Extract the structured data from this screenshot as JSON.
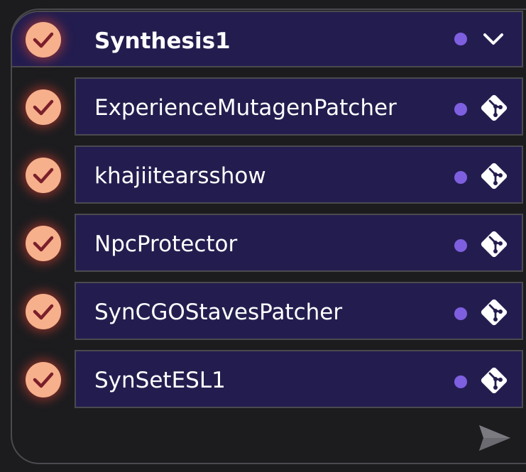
{
  "group": {
    "title": "Synthesis1",
    "checked": true,
    "expanded": true
  },
  "patchers": [
    {
      "label": "ExperienceMutagenPatcher",
      "checked": true,
      "icon": "git-icon"
    },
    {
      "label": "khajiitearsshow",
      "checked": true,
      "icon": "git-icon"
    },
    {
      "label": "NpcProtector",
      "checked": true,
      "icon": "git-icon"
    },
    {
      "label": "SynCGOStavesPatcher",
      "checked": true,
      "icon": "git-icon"
    },
    {
      "label": "SynSetESL1",
      "checked": true,
      "icon": "git-icon"
    }
  ],
  "colors": {
    "background": "#1c1c1f",
    "row_fill": "#231d4f",
    "border": "#4a4a4f",
    "status_dot": "#7e5fe0",
    "check_fill": "#f6b08c",
    "check_mark": "#7a1f2a",
    "send_icon": "#7a7a80"
  }
}
